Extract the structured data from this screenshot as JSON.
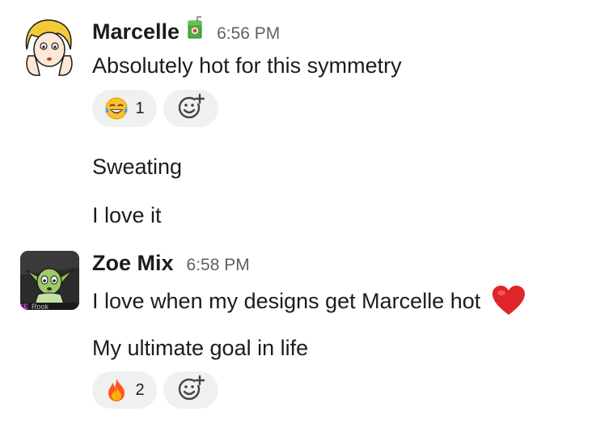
{
  "messages": [
    {
      "author": "Marcelle",
      "status_icon": "juice-box-icon",
      "time": "6:56 PM",
      "lines": [
        "Absolutely hot for this symmetry"
      ],
      "reactions": [
        {
          "emoji": "laughing-crying-emoji",
          "count": "1"
        }
      ],
      "followups": [
        "Sweating",
        "I love it"
      ]
    },
    {
      "author": "Zoe Mix",
      "time": "6:58 PM",
      "lines": [
        "I love when my designs get Marcelle hot",
        "My ultimate goal in life"
      ],
      "reactions": [
        {
          "emoji": "fire-emoji",
          "count": "2"
        }
      ]
    }
  ],
  "colors": {
    "text": "#1d1c1d",
    "timestamp": "#616061",
    "pill_bg": "#f0f0f0",
    "heart": "#e0262a"
  }
}
